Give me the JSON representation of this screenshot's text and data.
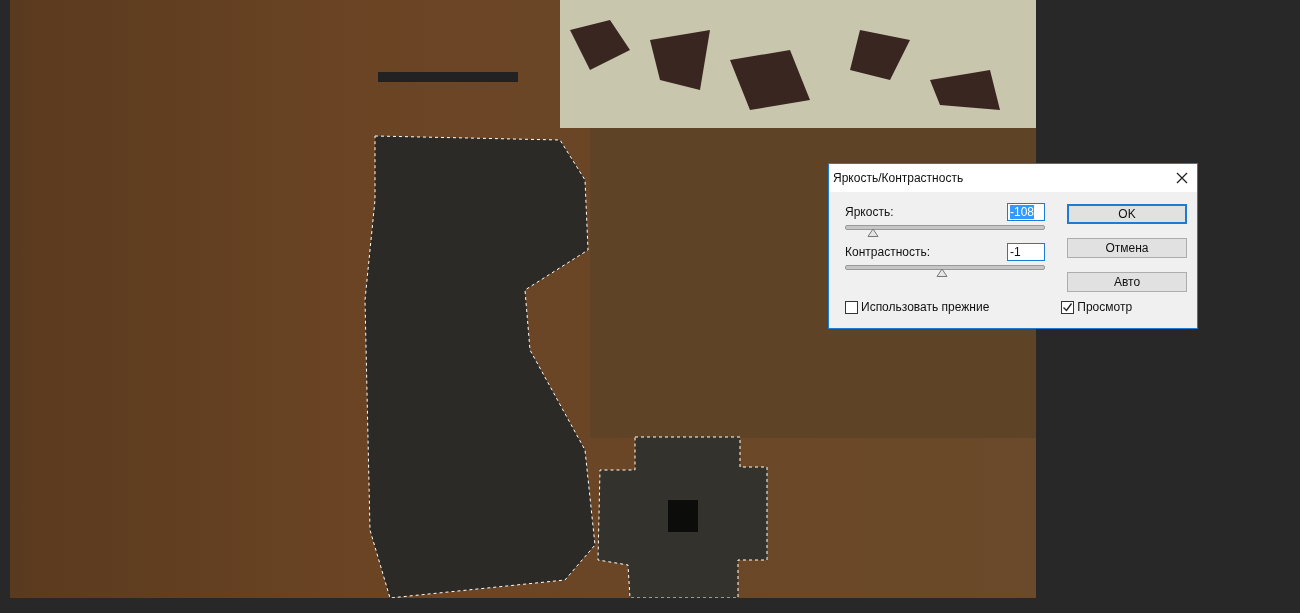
{
  "dialog": {
    "title": "Яркость/Контрастность",
    "sliders": [
      {
        "label": "Яркость:",
        "value": "-108",
        "value_selected": true,
        "level": 0.14
      },
      {
        "label": "Контрастность:",
        "value": "-1",
        "value_selected": false,
        "level": 0.49
      }
    ],
    "buttons": [
      {
        "label": "OK",
        "default": true
      },
      {
        "label": "Отмена",
        "default": false
      },
      {
        "label": "Авто",
        "default": false
      }
    ],
    "checkboxes": [
      {
        "label": "Использовать прежние",
        "checked": false
      },
      {
        "label": "Просмотр",
        "checked": true
      }
    ]
  }
}
